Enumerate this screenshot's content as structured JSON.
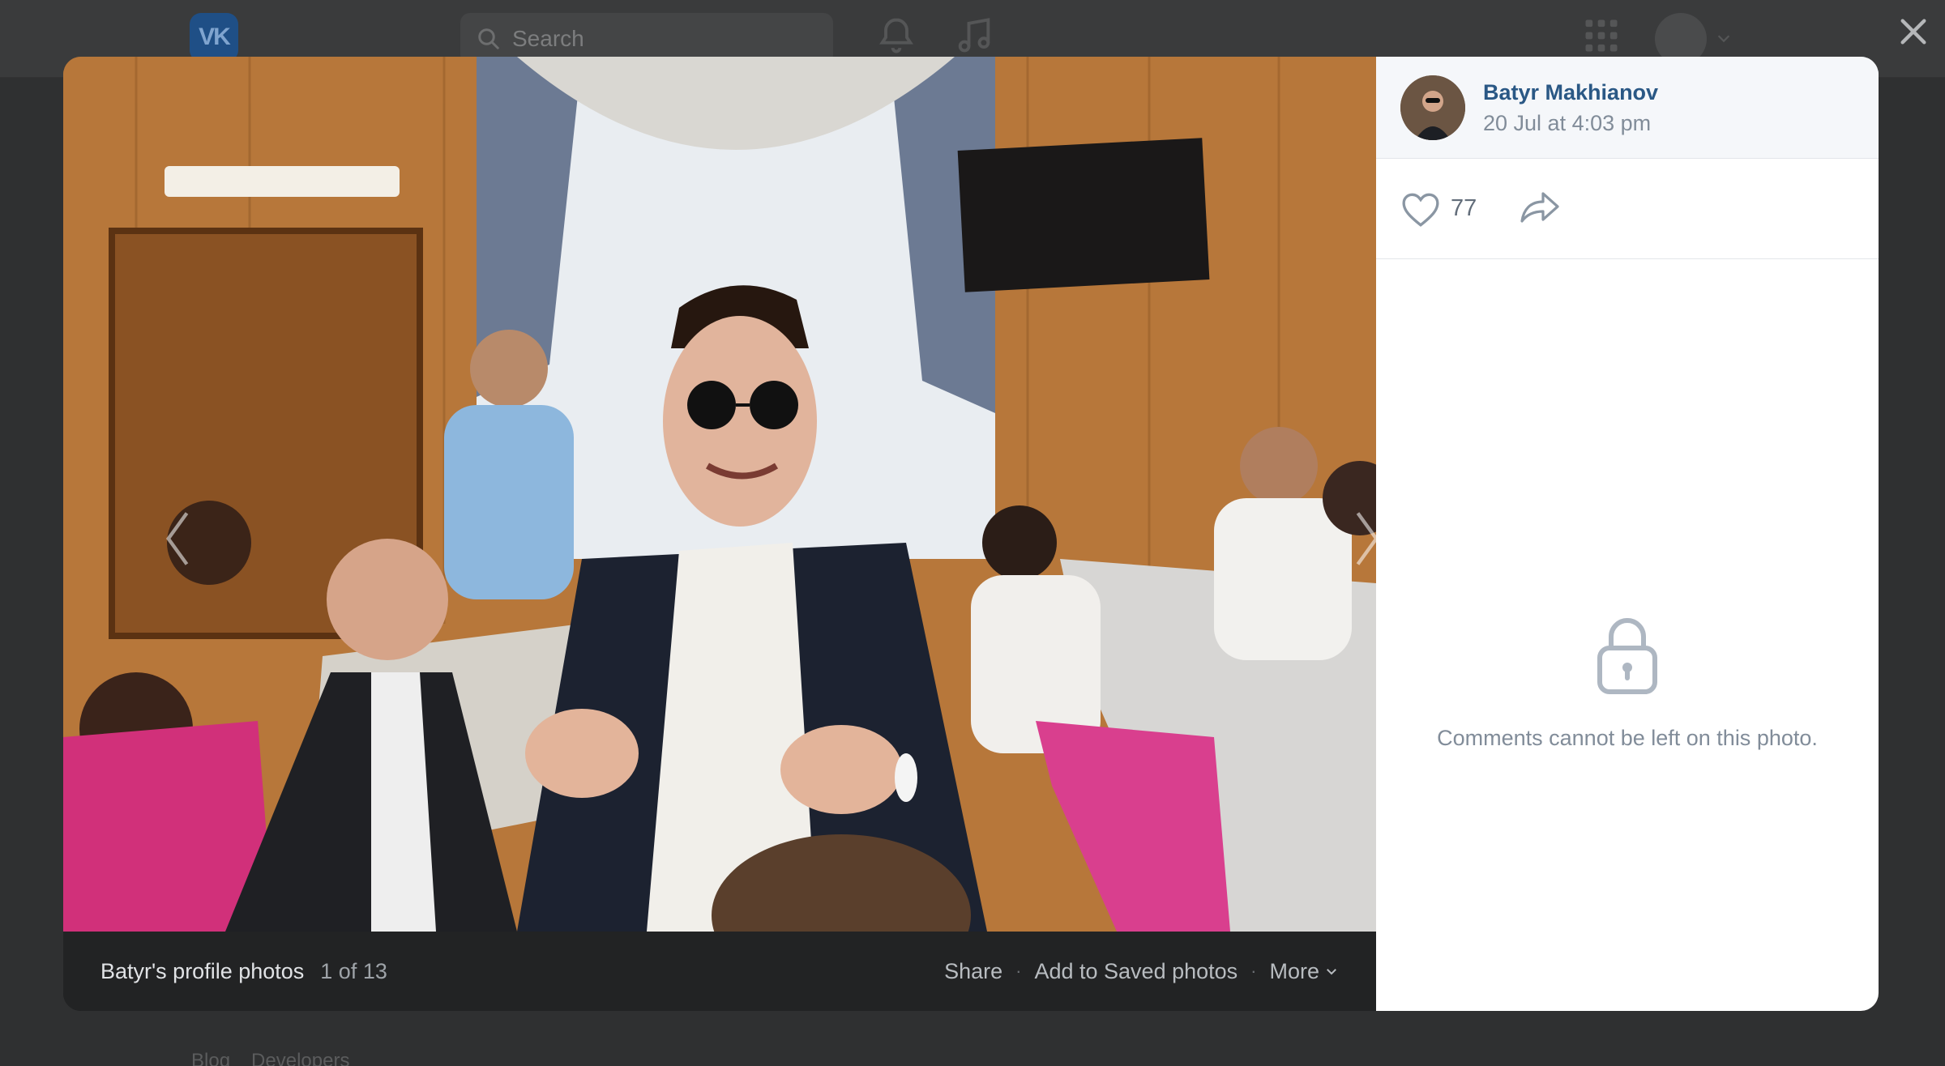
{
  "header": {
    "logo_text": "VK",
    "search_placeholder": "Search"
  },
  "footer": {
    "links": [
      "Blog",
      "Developers"
    ]
  },
  "viewer": {
    "album_title": "Batyr's profile photos",
    "counter": "1 of 13",
    "actions": {
      "share": "Share",
      "add_saved": "Add to Saved photos",
      "more": "More"
    }
  },
  "author": {
    "name": "Batyr Makhianov",
    "date": "20 Jul at 4:03 pm"
  },
  "reactions": {
    "likes": "77"
  },
  "comments": {
    "locked_message": "Comments cannot be left on this photo."
  },
  "colors": {
    "link": "#2a5885",
    "muted": "#818c99",
    "overlay": "#2f3031"
  }
}
